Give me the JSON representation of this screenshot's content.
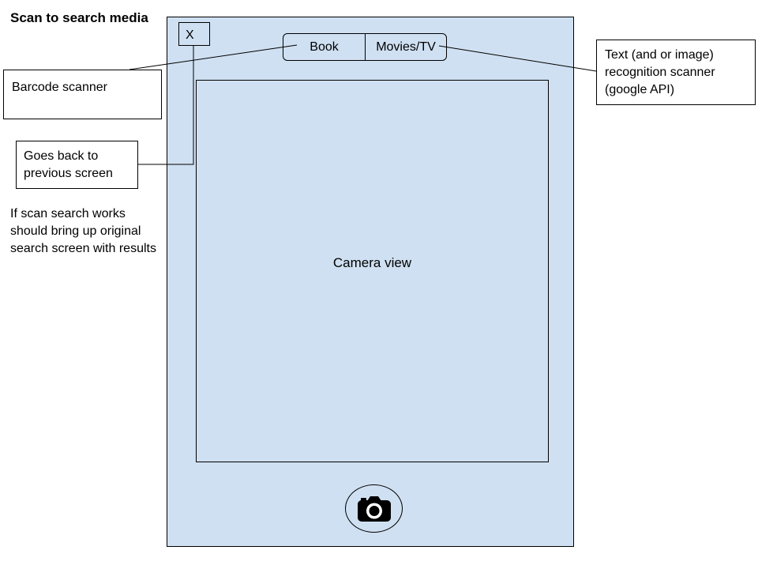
{
  "title": "Scan to search media",
  "annotations": {
    "barcode": "Barcode scanner",
    "back": "Goes back to previous screen",
    "text_recognition": "Text (and or image) recognition scanner (google API)",
    "scan_result": "If scan search works should bring up original search screen with results"
  },
  "screen": {
    "close_label": "X",
    "tabs": [
      {
        "label": "Book"
      },
      {
        "label": "Movies/TV"
      }
    ],
    "camera_view_label": "Camera view",
    "capture_icon": "camera-icon"
  },
  "colors": {
    "screen_bg": "#cfe0f2",
    "line": "#000000"
  }
}
